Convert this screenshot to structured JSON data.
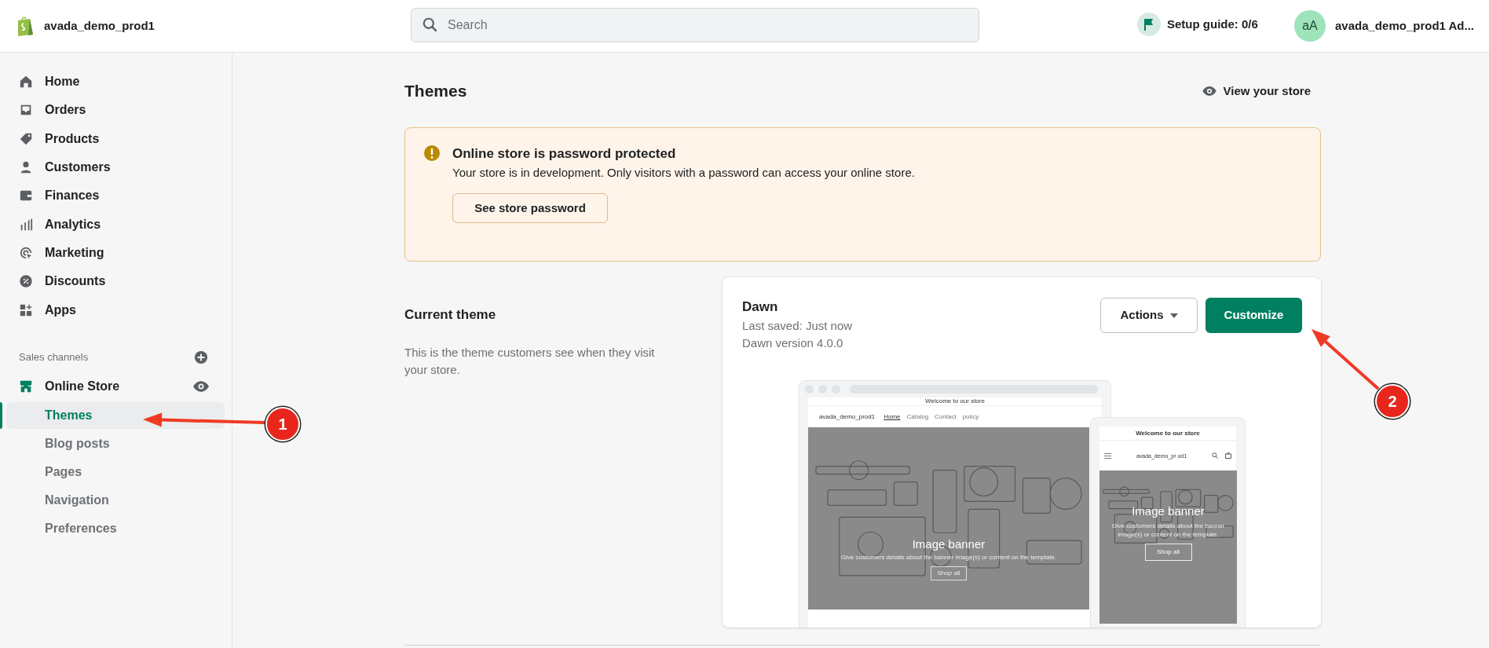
{
  "top_bar": {
    "store_name": "avada_demo_prod1",
    "search": {
      "placeholder": "Search"
    },
    "setup_guide": "Setup guide: 0/6",
    "avatar_initials": "aA",
    "account_name": "avada_demo_prod1 Ad..."
  },
  "sidebar": {
    "items": [
      {
        "label": "Home"
      },
      {
        "label": "Orders"
      },
      {
        "label": "Products"
      },
      {
        "label": "Customers"
      },
      {
        "label": "Finances"
      },
      {
        "label": "Analytics"
      },
      {
        "label": "Marketing"
      },
      {
        "label": "Discounts"
      },
      {
        "label": "Apps"
      }
    ],
    "section_title": "Sales channels",
    "channel": {
      "label": "Online Store"
    },
    "sub_items": [
      {
        "label": "Themes",
        "selected": true
      },
      {
        "label": "Blog posts",
        "selected": false
      },
      {
        "label": "Pages",
        "selected": false
      },
      {
        "label": "Navigation",
        "selected": false
      },
      {
        "label": "Preferences",
        "selected": false
      }
    ]
  },
  "main": {
    "title": "Themes",
    "view_store_link": "View your store",
    "alert": {
      "title": "Online store is password protected",
      "text": "Your store is in development. Only visitors with a password can access your online store.",
      "button": "See store password"
    },
    "current_theme": {
      "heading": "Current theme",
      "description": "This is the theme customers see when they visit your store."
    },
    "theme_card": {
      "name": "Dawn",
      "last_saved": "Last saved: Just now",
      "version": "Dawn version 4.0.0",
      "actions_button": "Actions",
      "customize_button": "Customize",
      "preview": {
        "desktop": {
          "announcement": "Welcome to our store",
          "store_name": "avada_demo_prod1",
          "nav": [
            {
              "label": "Home",
              "selected": true
            },
            {
              "label": "Catalog",
              "selected": false
            },
            {
              "label": "Contact",
              "selected": false
            },
            {
              "label": "policy",
              "selected": false
            }
          ],
          "banner_title": "Image banner",
          "banner_text": "Give customers details about the banner image(s) or content on the template.",
          "banner_button": "Shop all"
        },
        "mobile": {
          "announcement": "Welcome to our store",
          "store_name": "avada_demo_pr od1",
          "banner_title": "Image banner",
          "banner_text": "Give customers details about the banner image(s) or content on the template.",
          "banner_button": "Shop all"
        }
      }
    }
  },
  "annotations": [
    {
      "number": "1"
    },
    {
      "number": "2"
    }
  ]
}
